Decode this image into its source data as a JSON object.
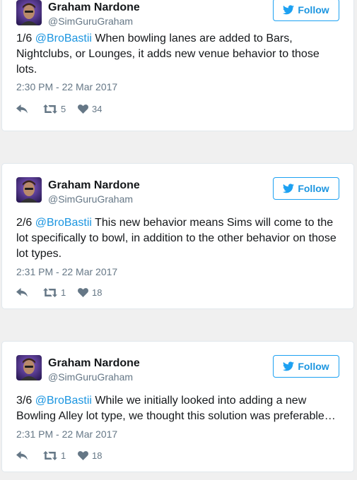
{
  "brand_color": "#1da1f2",
  "mention_color": "#1b95e0",
  "tweets": [
    {
      "author": {
        "name": "Graham Nardone",
        "handle": "@SimGuruGraham"
      },
      "follow_label": "Follow",
      "index": "1/6",
      "mention": "@BroBastii",
      "body": "When bowling lanes are added to Bars, Nightclubs, or Lounges, it adds new venue behavior to those lots.",
      "timestamp": "2:30 PM - 22 Mar 2017",
      "retweets": "5",
      "likes": "34"
    },
    {
      "author": {
        "name": "Graham Nardone",
        "handle": "@SimGuruGraham"
      },
      "follow_label": "Follow",
      "index": "2/6",
      "mention": "@BroBastii",
      "body": "This new behavior means Sims will come to the lot specifically to bowl, in addition to the other behavior on those lot types.",
      "timestamp": "2:31 PM - 22 Mar 2017",
      "retweets": "1",
      "likes": "18"
    },
    {
      "author": {
        "name": "Graham Nardone",
        "handle": "@SimGuruGraham"
      },
      "follow_label": "Follow",
      "index": "3/6",
      "mention": "@BroBastii",
      "body": "While we initially looked into adding a new Bowling Alley lot type, we thought this solution was preferable…",
      "timestamp": "2:31 PM - 22 Mar 2017",
      "retweets": "1",
      "likes": "18"
    }
  ],
  "icons": {
    "reply": "reply-icon",
    "retweet": "retweet-icon",
    "like": "heart-icon",
    "follow": "twitter-bird-icon"
  }
}
